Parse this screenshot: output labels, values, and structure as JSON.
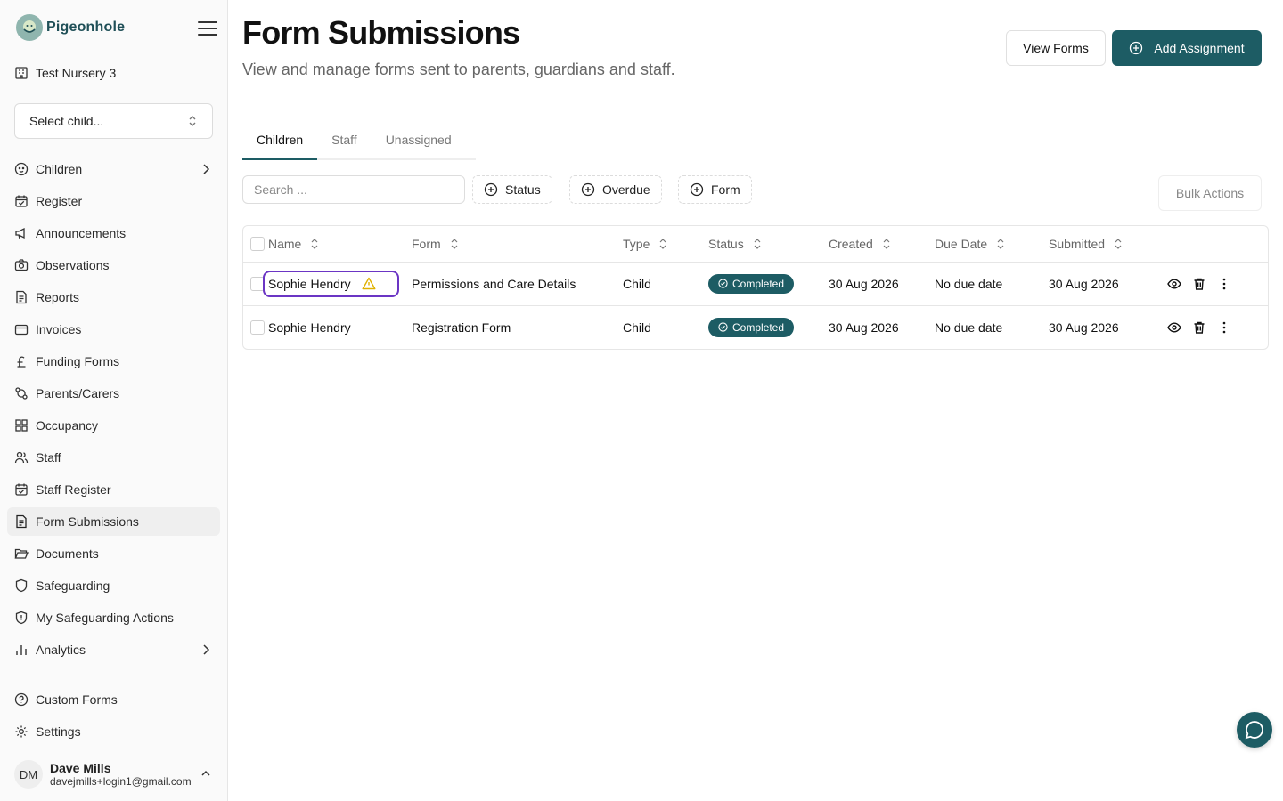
{
  "app": {
    "name": "Pigeonhole"
  },
  "sidebar": {
    "nursery": "Test Nursery 3",
    "child_select": {
      "placeholder": "Select child..."
    },
    "items": [
      {
        "label": "Children",
        "icon": "baby-face-icon",
        "has_submenu": true
      },
      {
        "label": "Register",
        "icon": "calendar-check-icon"
      },
      {
        "label": "Announcements",
        "icon": "megaphone-icon"
      },
      {
        "label": "Observations",
        "icon": "camera-icon"
      },
      {
        "label": "Reports",
        "icon": "file-text-icon"
      },
      {
        "label": "Invoices",
        "icon": "wallet-icon"
      },
      {
        "label": "Funding Forms",
        "icon": "pound-sign-icon"
      },
      {
        "label": "Parents/Carers",
        "icon": "users-link-icon"
      },
      {
        "label": "Occupancy",
        "icon": "grid-icon"
      },
      {
        "label": "Staff",
        "icon": "users-icon"
      },
      {
        "label": "Staff Register",
        "icon": "calendar-check-icon"
      },
      {
        "label": "Form Submissions",
        "icon": "file-text-icon",
        "active": true
      },
      {
        "label": "Documents",
        "icon": "folder-open-icon"
      },
      {
        "label": "Safeguarding",
        "icon": "shield-icon"
      },
      {
        "label": "My Safeguarding Actions",
        "icon": "shield-alert-icon"
      },
      {
        "label": "Analytics",
        "icon": "bar-chart-icon",
        "has_submenu": true
      }
    ],
    "bottom_items": [
      {
        "label": "Custom Forms",
        "icon": "help-circle-icon"
      },
      {
        "label": "Settings",
        "icon": "gear-icon"
      }
    ],
    "user": {
      "initials": "DM",
      "name": "Dave Mills",
      "email": "davejmills+login1@gmail.com"
    }
  },
  "header": {
    "title": "Form Submissions",
    "subtitle": "View and manage forms sent to parents, guardians and staff.",
    "view_forms_label": "View Forms",
    "add_assignment_label": "Add Assignment"
  },
  "tabs": [
    {
      "label": "Children",
      "active": true
    },
    {
      "label": "Staff"
    },
    {
      "label": "Unassigned"
    }
  ],
  "toolbar": {
    "search_placeholder": "Search ...",
    "filters": [
      "Status",
      "Overdue",
      "Form"
    ],
    "bulk_actions_label": "Bulk Actions"
  },
  "table": {
    "columns": [
      "Name",
      "Form",
      "Type",
      "Status",
      "Created",
      "Due Date",
      "Submitted"
    ],
    "rows": [
      {
        "name": "Sophie Hendry",
        "warning": true,
        "form": "Permissions and Care Details",
        "type": "Child",
        "status": "Completed",
        "created": "30 Aug 2026",
        "due": "No due date",
        "submitted": "30 Aug 2026"
      },
      {
        "name": "Sophie Hendry",
        "warning": false,
        "form": "Registration Form",
        "type": "Child",
        "status": "Completed",
        "created": "30 Aug 2026",
        "due": "No due date",
        "submitted": "30 Aug 2026"
      }
    ]
  },
  "colors": {
    "primary": "#1d5c64",
    "highlight": "#6b35c4",
    "warning": "#e0b100"
  }
}
